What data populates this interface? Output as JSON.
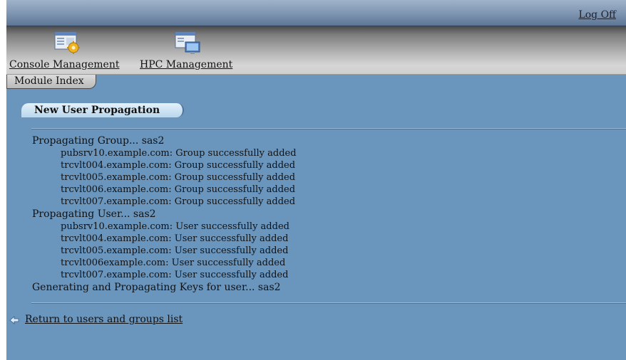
{
  "header": {
    "logoff_label": "Log Off"
  },
  "nav": {
    "items": [
      {
        "label": "Console Management",
        "icon": "console-management-icon"
      },
      {
        "label": "HPC Management",
        "icon": "hpc-management-icon"
      }
    ]
  },
  "module_tab": {
    "label": "Module Index"
  },
  "section": {
    "title": "New User Propagation"
  },
  "log": {
    "group_heading": "Propagating Group... sas2",
    "group_results": [
      "pubsrv10.example.com: Group successfully added",
      "trcvlt004.example.com: Group successfully added",
      "trcvlt005.example.com: Group successfully added",
      "trcvlt006.example.com: Group successfully added",
      "trcvlt007.example.com: Group successfully added"
    ],
    "user_heading": "Propagating User... sas2",
    "user_results": [
      "pubsrv10.example.com: User successfully added",
      "trcvlt004.example.com: User successfully added",
      "trcvlt005.example.com: User successfully added",
      "trcvlt006example.com: User successfully added",
      "trcvlt007.example.com: User successfully added"
    ],
    "keys_heading": "Generating and Propagating Keys for user... sas2"
  },
  "return_link": {
    "label": "Return to users and groups list",
    "icon": "back-arrow-icon"
  },
  "colors": {
    "background": "#6a95bd",
    "section_tab": "#cfe6f6"
  }
}
